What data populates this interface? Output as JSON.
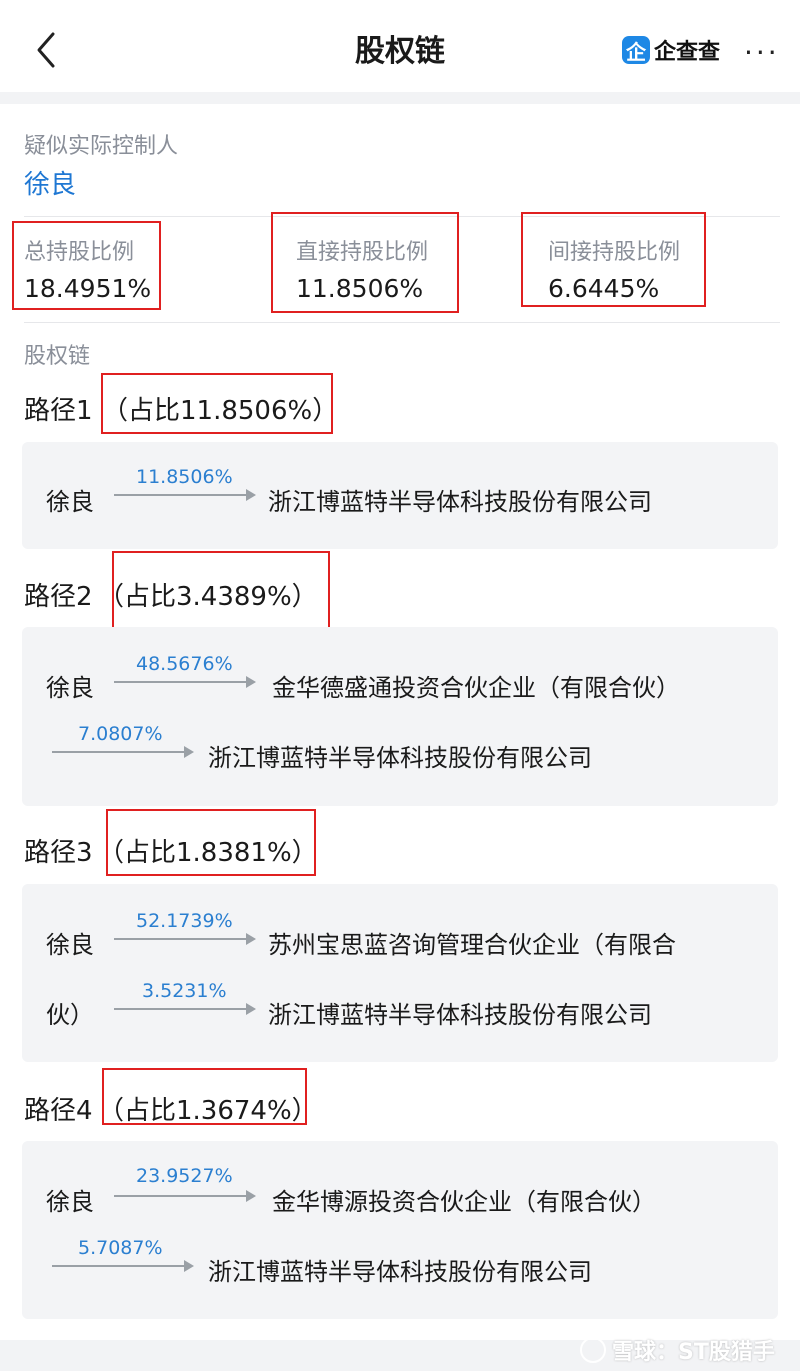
{
  "header": {
    "title": "股权链",
    "brand_icon": "企",
    "brand_name": "企查查",
    "more": "···"
  },
  "controller": {
    "label": "疑似实际控制人",
    "name": "徐良"
  },
  "stats": {
    "total": {
      "label": "总持股比例",
      "value": "18.4951%"
    },
    "direct": {
      "label": "直接持股比例",
      "value": "11.8506%"
    },
    "indirect": {
      "label": "间接持股比例",
      "value": "6.6445%"
    }
  },
  "section_label": "股权链",
  "paths": [
    {
      "title": "路径1",
      "ratio": "（占比11.8506%）",
      "nodes": {
        "start": "徐良",
        "pct1": "11.8506%",
        "company1": "浙江博蓝特半导体科技股份有限公司"
      }
    },
    {
      "title": "路径2",
      "ratio": "（占比3.4389%）",
      "nodes": {
        "start": "徐良",
        "pct1": "48.5676%",
        "company1": "金华德盛通投资合伙企业（有限合伙）",
        "pct2": "7.0807%",
        "company2": "浙江博蓝特半导体科技股份有限公司"
      }
    },
    {
      "title": "路径3",
      "ratio": "（占比1.8381%）",
      "nodes": {
        "start": "徐良",
        "pct1": "52.1739%",
        "company1": "苏州宝思蓝咨询管理合伙企业（有限合",
        "wrap": "伙）",
        "pct2": "3.5231%",
        "company2": "浙江博蓝特半导体科技股份有限公司"
      }
    },
    {
      "title": "路径4",
      "ratio": "（占比1.3674%）",
      "nodes": {
        "start": "徐良",
        "pct1": "23.9527%",
        "company1": "金华博源投资合伙企业（有限合伙）",
        "pct2": "5.7087%",
        "company2": "浙江博蓝特半导体科技股份有限公司"
      }
    }
  ],
  "watermark": "雪球：ST股猎手",
  "colors": {
    "accent": "#1e77d3",
    "highlight_box": "#e02020",
    "card_bg": "#f3f4f6"
  }
}
